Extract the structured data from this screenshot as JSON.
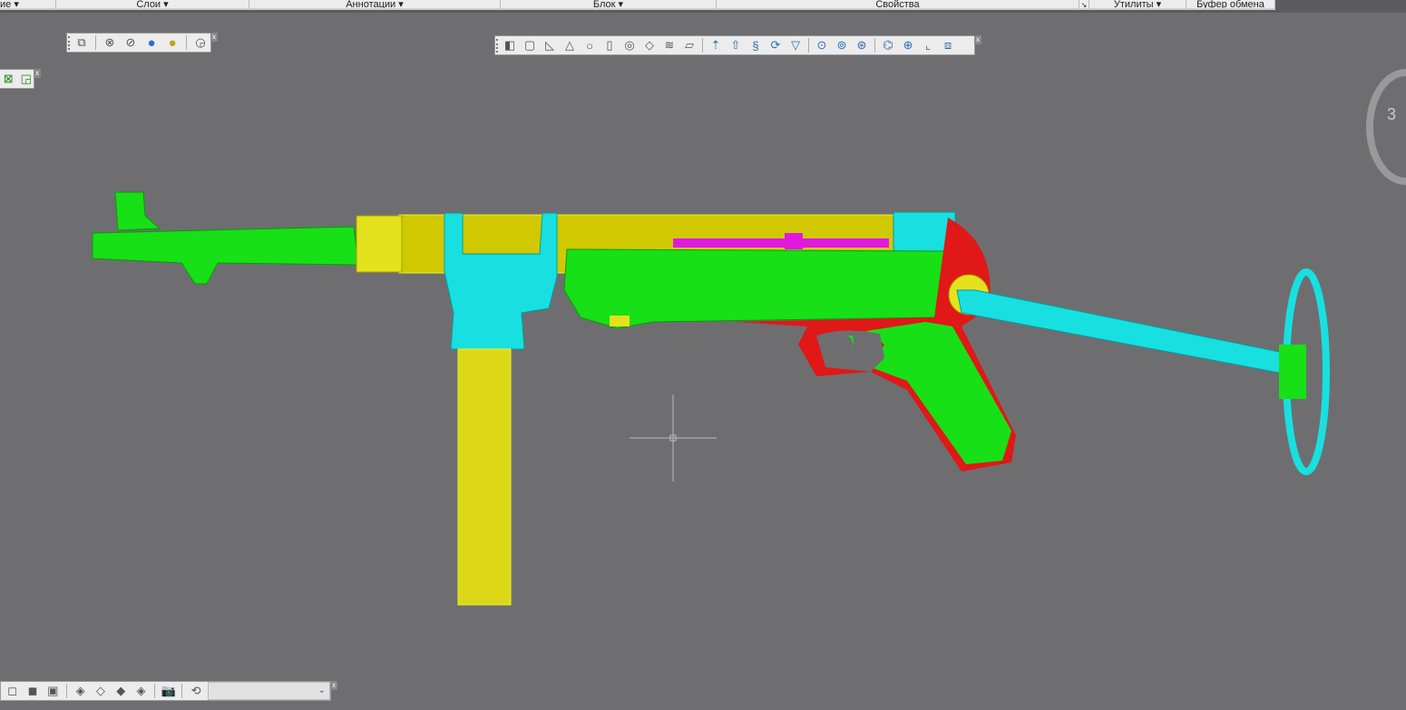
{
  "ribbon": {
    "panels": [
      {
        "label": "ие ▾"
      },
      {
        "label": "Слои ▾"
      },
      {
        "label": "Аннотации ▾"
      },
      {
        "label": "Блок ▾"
      },
      {
        "label": "Свойства"
      },
      {
        "label": "↘"
      },
      {
        "label": "Утилиты ▾"
      },
      {
        "label": "Буфер обмена"
      }
    ]
  },
  "viewcube": {
    "label": "3"
  },
  "toolbars": {
    "visual": [
      "box-union-icon",
      "circle-cross-icon",
      "circle-x-icon",
      "sphere-blue-icon",
      "sphere-gold-icon",
      "render-settings-icon"
    ],
    "modeling": [
      "polysolid-icon",
      "box-icon",
      "wedge-icon",
      "cone-icon",
      "sphere-icon",
      "cylinder-icon",
      "torus-icon",
      "pyramid-icon",
      "helix-icon",
      "planar-surface-icon",
      "extrude-icon",
      "presspull-icon",
      "sweep-icon",
      "revolve-icon",
      "loft-icon",
      "union-icon",
      "subtract-icon",
      "intersect-icon",
      "3d-move-icon",
      "3d-rotate-icon",
      "3d-align-icon",
      "3d-array-icon"
    ],
    "views": [
      "top-view-icon",
      "front-view-icon",
      "left-view-icon",
      "sw-iso-icon",
      "se-iso-icon",
      "ne-iso-icon",
      "nw-iso-icon",
      "camera-icon",
      "ucs-previous-icon"
    ],
    "views_combo": {
      "value": ""
    }
  },
  "colors": {
    "bg": "#6e6e70",
    "green": "#17e017",
    "yellow": "#e4e21c",
    "cyan": "#18e0e0",
    "red": "#e01818",
    "magenta": "#e018e0"
  }
}
